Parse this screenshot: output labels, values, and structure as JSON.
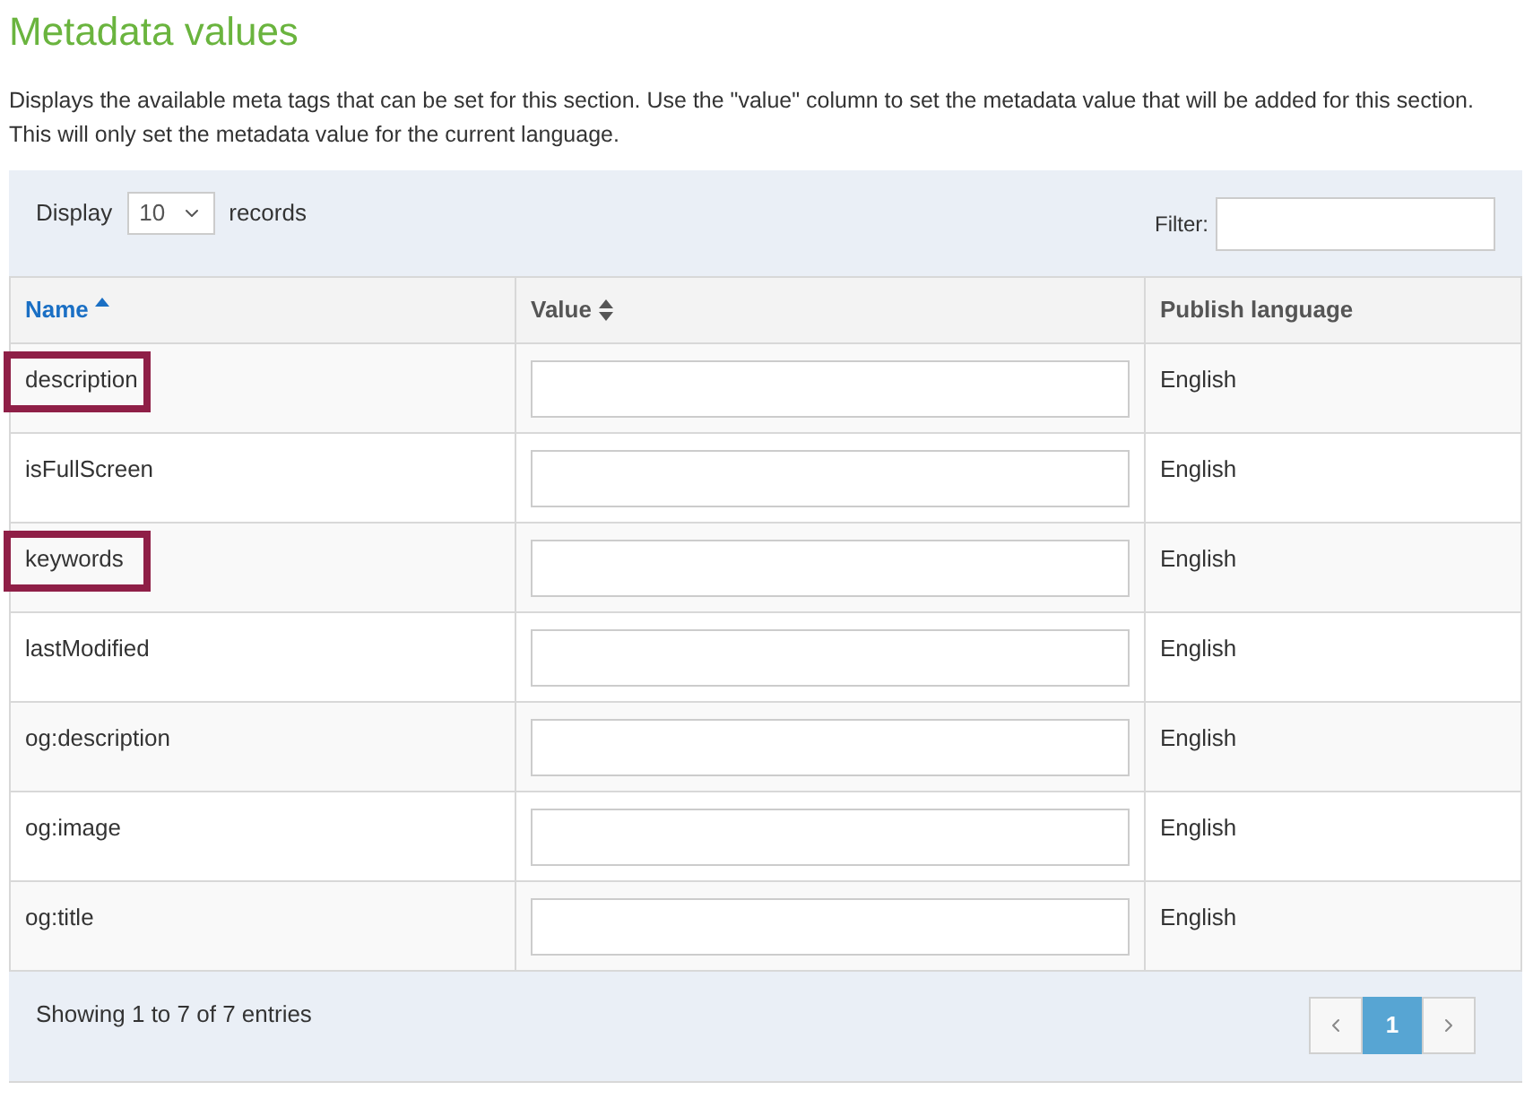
{
  "heading": "Metadata values",
  "description": "Displays the available meta tags that can be set for this section. Use the \"value\" column to set the metadata value that will be added for this section. This will only set the metadata value for the current language.",
  "length_menu": {
    "before": "Display",
    "value": "10",
    "after": "records"
  },
  "filter": {
    "label": "Filter:"
  },
  "table": {
    "columns": [
      {
        "label": "Name",
        "sortable": true,
        "sorted": true
      },
      {
        "label": "Value",
        "sortable": true,
        "sorted": false
      },
      {
        "label": "Publish language",
        "sortable": false,
        "sorted": false
      }
    ],
    "rows": [
      {
        "name": "description",
        "language": "English",
        "highlighted": true
      },
      {
        "name": "isFullScreen",
        "language": "English",
        "highlighted": false
      },
      {
        "name": "keywords",
        "language": "English",
        "highlighted": true
      },
      {
        "name": "lastModified",
        "language": "English",
        "highlighted": false
      },
      {
        "name": "og:description",
        "language": "English",
        "highlighted": false
      },
      {
        "name": "og:image",
        "language": "English",
        "highlighted": false
      },
      {
        "name": "og:title",
        "language": "English",
        "highlighted": false
      }
    ]
  },
  "info": "Showing 1 to 7 of 7 entries",
  "pagination": {
    "pages": [
      {
        "label": "1",
        "selected": true
      }
    ]
  }
}
